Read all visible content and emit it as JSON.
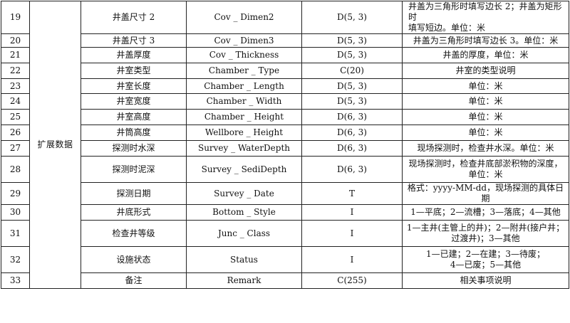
{
  "group_label": "扩展数据",
  "rows": [
    {
      "no": "19",
      "name": "井盖尺寸 2",
      "field": "Cov _ Dimen2",
      "type": "D(5, 3)",
      "desc": [
        "井盖为三角形时填写边长 2；井盖为矩形时",
        "填写短边。单位：米"
      ],
      "align": "left"
    },
    {
      "no": "20",
      "name": "井盖尺寸 3",
      "field": "Cov _ Dimen3",
      "type": "D(5, 3)",
      "desc": [
        "井盖为三角形时填写边长 3。单位：米"
      ],
      "align": "center"
    },
    {
      "no": "21",
      "name": "井盖厚度",
      "field": "Cov _ Thickness",
      "type": "D(5, 3)",
      "desc": [
        "井盖的厚度，单位：米"
      ],
      "align": "center"
    },
    {
      "no": "22",
      "name": "井室类型",
      "field": "Chamber _ Type",
      "type": "C(20)",
      "desc": [
        "井室的类型说明"
      ],
      "align": "center"
    },
    {
      "no": "23",
      "name": "井室长度",
      "field": "Chamber _ Length",
      "type": "D(5, 3)",
      "desc": [
        "单位：米"
      ],
      "align": "center"
    },
    {
      "no": "24",
      "name": "井室宽度",
      "field": "Chamber _ Width",
      "type": "D(5, 3)",
      "desc": [
        "单位：米"
      ],
      "align": "center"
    },
    {
      "no": "25",
      "name": "井室高度",
      "field": "Chamber _ Height",
      "type": "D(6, 3)",
      "desc": [
        "单位：米"
      ],
      "align": "center"
    },
    {
      "no": "26",
      "name": "井筒高度",
      "field": "Wellbore _ Height",
      "type": "D(6, 3)",
      "desc": [
        "单位：米"
      ],
      "align": "center"
    },
    {
      "no": "27",
      "name": "探测时水深",
      "field": "Survey _ WaterDepth",
      "type": "D(6, 3)",
      "desc": [
        "现场探测时，检查井水深。单位：米"
      ],
      "align": "center"
    },
    {
      "no": "28",
      "name": "探测时泥深",
      "field": "Survey _ SediDepth",
      "type": "D(6, 3)",
      "desc": [
        "现场探测时，检查井底部淤积物的深度，",
        "单位：米"
      ],
      "align": "center"
    },
    {
      "no": "29",
      "name": "探测日期",
      "field": "Survey _ Date",
      "type": "T",
      "desc": [
        "格式：yyyy-MM-dd，现场探测的具体日期"
      ],
      "align": "center"
    },
    {
      "no": "30",
      "name": "井底形式",
      "field": "Bottom _ Style",
      "type": "I",
      "desc": [
        "1—平底；2—流槽；3—落底；4—其他"
      ],
      "align": "center"
    },
    {
      "no": "31",
      "name": "检查井等级",
      "field": "Junc _ Class",
      "type": "I",
      "desc": [
        "1—主井(主管上的井)；2—附井(接户井；",
        "过渡井)；3—其他"
      ],
      "align": "center"
    },
    {
      "no": "32",
      "name": "设施状态",
      "field": "Status",
      "type": "I",
      "desc": [
        "1—已建；2—在建；3—待废；",
        "4—已废；5—其他"
      ],
      "align": "center"
    },
    {
      "no": "33",
      "name": "备注",
      "field": "Remark",
      "type": "C(255)",
      "desc": [
        "相关事项说明"
      ],
      "align": "center"
    }
  ]
}
